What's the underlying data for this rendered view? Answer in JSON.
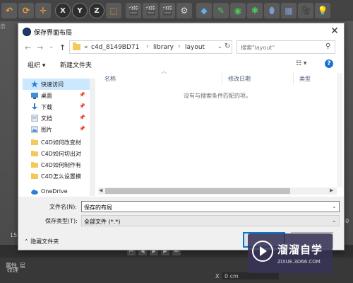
{
  "toolbar": {
    "buttons": [
      "↶",
      "⟳",
      "✛",
      "X",
      "Y",
      "Z",
      "⬚",
      "🎬",
      "🎬",
      "🎬",
      "⚙",
      "◆",
      "✎",
      "◉",
      "✱",
      "⬮",
      "▦",
      "🎥",
      "💡"
    ],
    "axis_labels": [
      "X",
      "Y",
      "Z"
    ]
  },
  "background": {
    "viewport_label": "示",
    "left_number": "15",
    "right_number": "30",
    "bottom_tabs": [
      "属性",
      "层",
      "纹理"
    ],
    "x_labels": [
      "X",
      "0 cm",
      "X",
      "0 cm"
    ]
  },
  "dialog": {
    "title": "保存界面布局",
    "close_icon": "✕",
    "nav": {
      "back": "←",
      "forward": "→",
      "dropdown": "⌄",
      "up": "↑"
    },
    "address": {
      "prefix": "«",
      "crumbs": [
        "c4d_8149BD71",
        "library",
        "layout"
      ],
      "separator": "›"
    },
    "search": {
      "placeholder": "搜索\"layout\"",
      "icon": "⚲"
    },
    "commands": {
      "organize": "组织 ▾",
      "new_folder": "新建文件夹",
      "view": "☷ ▾",
      "help": "?"
    },
    "sidebar": [
      {
        "label": "快速访问",
        "icon": "star",
        "active": true,
        "pinned": false
      },
      {
        "label": "桌面",
        "icon": "desktop",
        "active": false,
        "pinned": true
      },
      {
        "label": "下载",
        "icon": "download",
        "active": false,
        "pinned": true
      },
      {
        "label": "文档",
        "icon": "document",
        "active": false,
        "pinned": true
      },
      {
        "label": "图片",
        "icon": "picture",
        "active": false,
        "pinned": true
      },
      {
        "label": "C4D如何改变材",
        "icon": "folder",
        "active": false,
        "pinned": false
      },
      {
        "label": "C4D如何切出对",
        "icon": "folder",
        "active": false,
        "pinned": false
      },
      {
        "label": "C4D如何制作有",
        "icon": "folder",
        "active": false,
        "pinned": false
      },
      {
        "label": "C4D怎么设置模",
        "icon": "folder",
        "active": false,
        "pinned": false
      },
      {
        "label": "OneDrive",
        "icon": "cloud",
        "active": false,
        "pinned": false
      }
    ],
    "pin_icon": "📌",
    "columns": [
      "名称",
      "修改日期",
      "类型"
    ],
    "empty_message": "没有与搜索条件匹配的项。",
    "footer": {
      "filename_label": "文件名(N):",
      "filename_value": "保存的布局",
      "filetype_label": "保存类型(T):",
      "filetype_value": "全部文件 (*.*)",
      "hide_folders": "隐藏文件夹",
      "save_button": "",
      "cancel_button": ""
    }
  },
  "watermark": {
    "title": "溜溜自学",
    "url": "ZIXUE.3D66.COM"
  },
  "colors": {
    "accent": "#0078d7",
    "sidebar_active": "#cce8ff",
    "folder": "#f3c95b"
  }
}
